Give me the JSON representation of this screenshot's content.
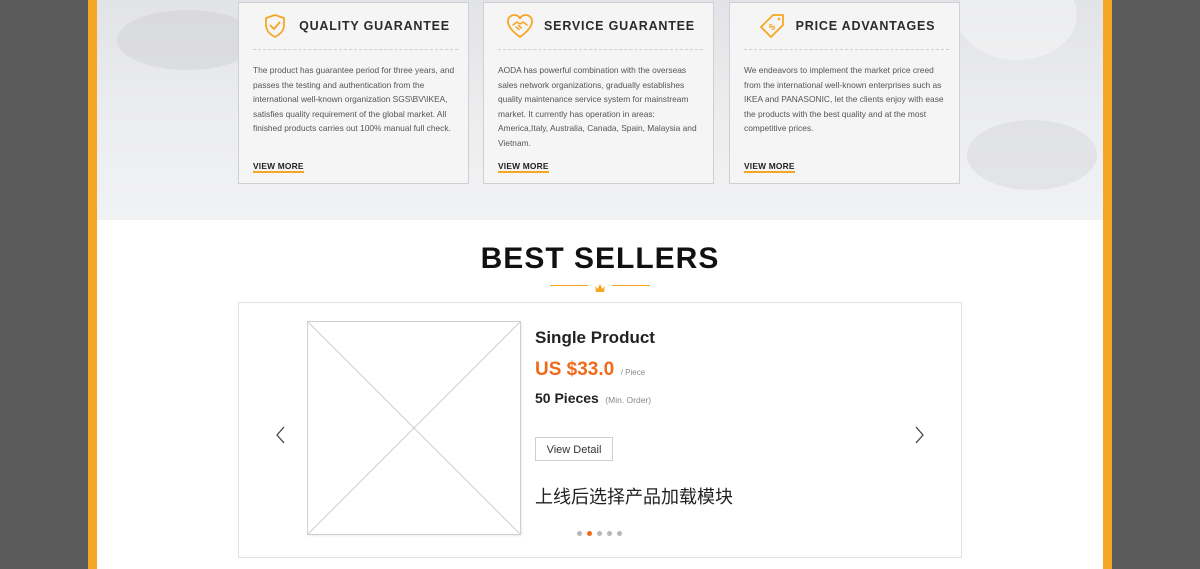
{
  "colors": {
    "accent": "#f5a623",
    "price": "#f06a1a",
    "outer_background": "#5a5a5a"
  },
  "features": [
    {
      "icon": "shield-check-icon",
      "title": "QUALITY GUARANTEE",
      "body": "The product has guarantee period for three years, and passes the testing and authentication   from the international well-known organization SGS\\BV\\IKEA, satisfies quality requirement of the global market. All finished products carries out 100% manual full check.",
      "link": "VIEW MORE"
    },
    {
      "icon": "handshake-heart-icon",
      "title": "SERVICE GUARANTEE",
      "body": "AODA has powerful combination with the overseas sales network organizations, gradually establishes quality maintenance service system for mainstream market. It currently has operation in areas: America,Italy, Australia, Canada, Spain, Malaysia and Vietnam.",
      "link": "VIEW MORE"
    },
    {
      "icon": "price-tag-dollar-icon",
      "title": "PRICE ADVANTAGES",
      "body": "We endeavors to implement the market price creed from the international well-known enterprises such as IKEA and PANASONIC, let the clients enjoy with ease the products with the best quality and at the most competitive prices.",
      "link": "VIEW MORE"
    }
  ],
  "best_sellers": {
    "title": "BEST SELLERS",
    "decoration_icon": "crown-icon",
    "product": {
      "image_icon": "image-placeholder-icon",
      "name": "Single Product",
      "price": "US $33.0",
      "unit": "/ Piece",
      "moq": "50 Pieces",
      "moq_note": "(Min. Order)",
      "detail_button": "View Detail",
      "note": "上线后选择产品加载模块"
    },
    "prev_icon": "chevron-left-icon",
    "next_icon": "chevron-right-icon",
    "pagination": {
      "count": 5,
      "active_index": 1
    }
  }
}
